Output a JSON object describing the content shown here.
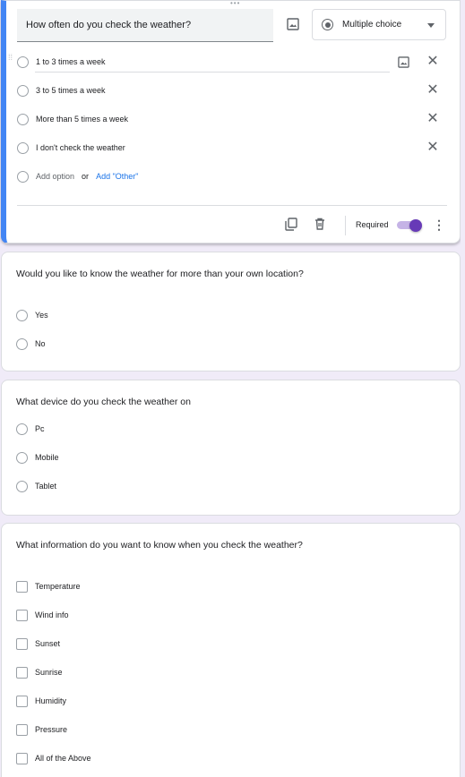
{
  "active_question": {
    "title": "How often do you check the weather?",
    "type_label": "Multiple choice",
    "options": [
      "1 to 3 times a week",
      "3 to 5 times a week",
      "More than 5 times a week",
      "I don't check the weather"
    ],
    "add_option": "Add option",
    "or": "or",
    "add_other": "Add \"Other\"",
    "required_label": "Required",
    "required_on": true
  },
  "questions": [
    {
      "title": "Would you like to know the weather for more than your own location?",
      "kind": "radio",
      "choices": [
        "Yes",
        "No"
      ]
    },
    {
      "title": "What device do you check the weather on",
      "kind": "radio",
      "choices": [
        "Pc",
        "Mobile",
        "Tablet"
      ]
    },
    {
      "title": "What information do you want to know when you check the weather?",
      "kind": "checkbox",
      "choices": [
        "Temperature",
        "Wind info",
        "Sunset",
        "Sunrise",
        "Humidity",
        "Pressure",
        "All of the Above"
      ]
    }
  ],
  "colors": {
    "accent_bar": "#4285f4",
    "toggle": "#673ab7",
    "link": "#1a73e8",
    "page_bg": "#f0ebf8"
  }
}
